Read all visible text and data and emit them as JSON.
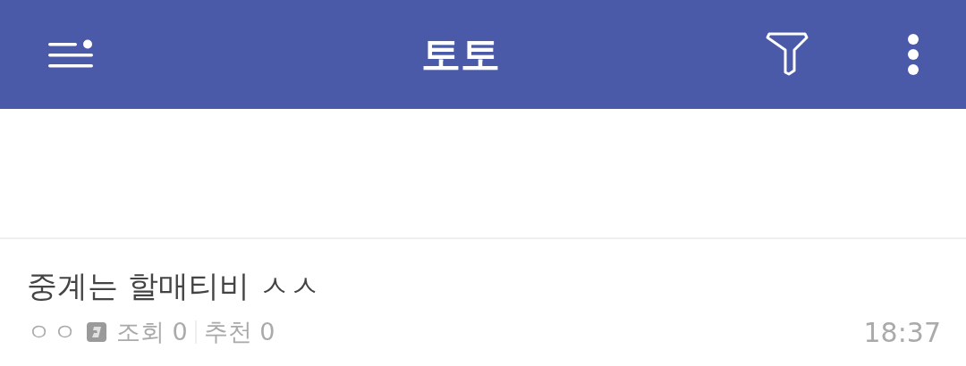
{
  "app_bar": {
    "title": "토토"
  },
  "posts": [
    {
      "title": "중계는 할매티비 ㅅㅅ",
      "author": "ㅇㅇ",
      "views_label": "조회",
      "views": "0",
      "likes_label": "추천",
      "likes": "0",
      "time": "18:37"
    }
  ]
}
